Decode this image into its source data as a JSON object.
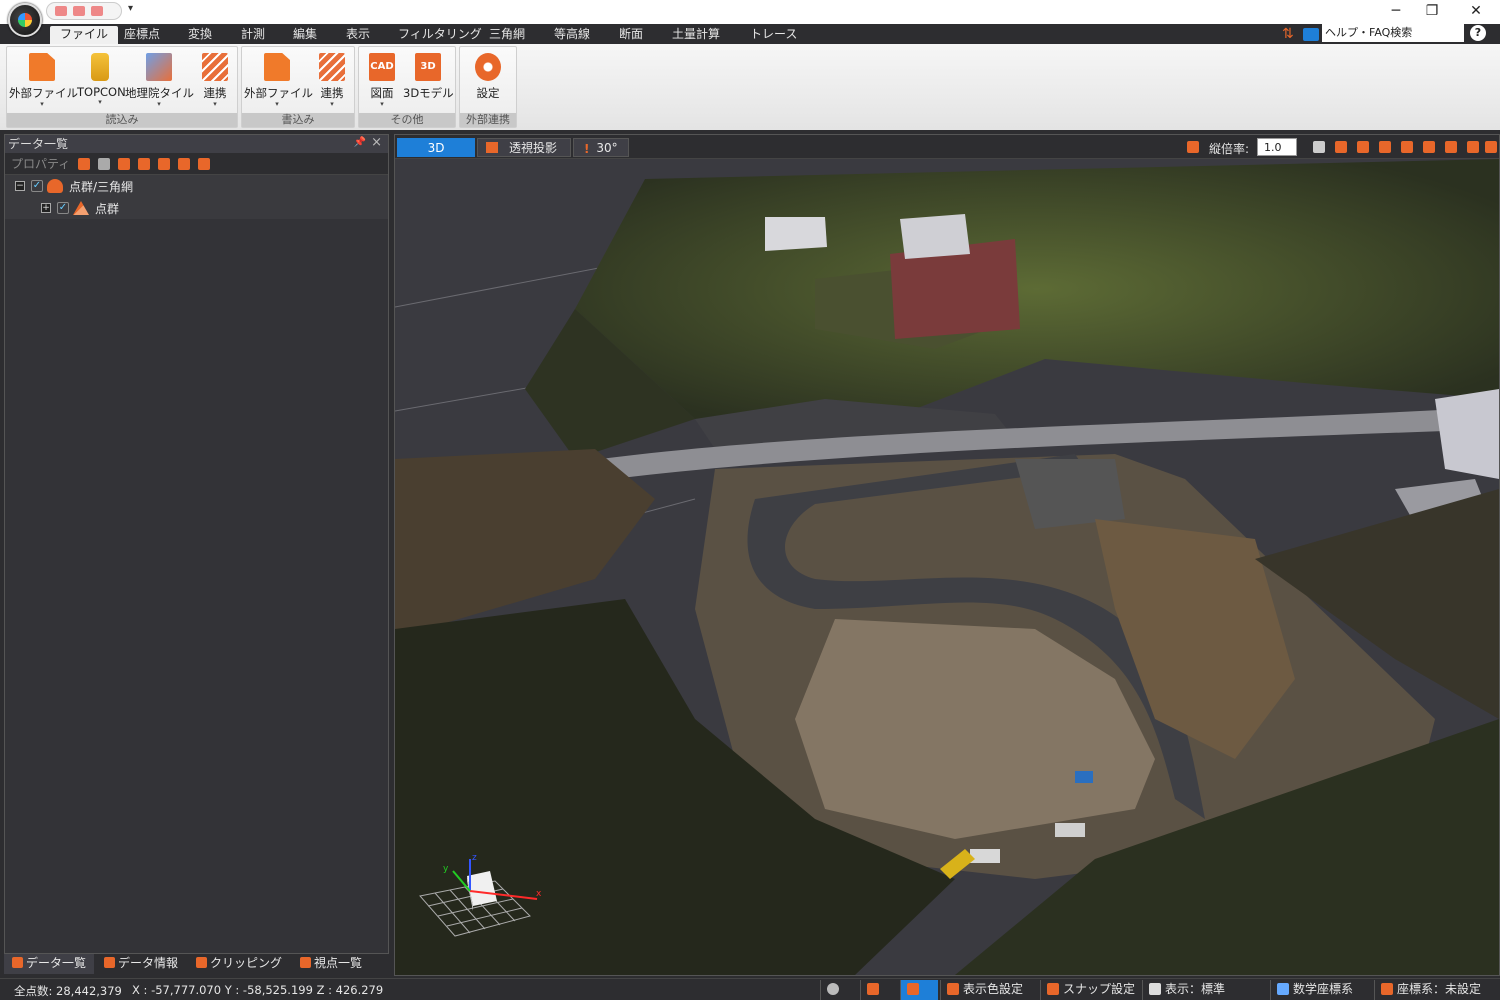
{
  "menu": {
    "tabs": [
      {
        "label": "ファイル"
      },
      {
        "label": "座標点"
      },
      {
        "label": "変換"
      },
      {
        "label": "計測"
      },
      {
        "label": "編集"
      },
      {
        "label": "表示"
      },
      {
        "label": "フィルタリング"
      },
      {
        "label": "三角網"
      },
      {
        "label": "等高線"
      },
      {
        "label": "断面"
      },
      {
        "label": "土量計算"
      },
      {
        "label": "トレース"
      }
    ],
    "help_search": "ヘルプ・FAQ検索"
  },
  "ribbon": {
    "groups": [
      {
        "label": "読込み",
        "buttons": [
          {
            "label": "外部ファイル"
          },
          {
            "label": "TOPCON"
          },
          {
            "label": "地理院タイル"
          },
          {
            "label": "連携"
          }
        ]
      },
      {
        "label": "書込み",
        "buttons": [
          {
            "label": "外部ファイル"
          },
          {
            "label": "連携"
          }
        ]
      },
      {
        "label": "その他",
        "buttons": [
          {
            "label": "図面",
            "icon_text": "CAD"
          },
          {
            "label": "3Dモデル",
            "icon_text": "3D"
          }
        ]
      },
      {
        "label": "外部連携",
        "buttons": [
          {
            "label": "設定"
          }
        ]
      }
    ]
  },
  "panel": {
    "title": "データ一覧",
    "toolbar_property": "プロパティ",
    "tree": [
      {
        "label": "点群/三角網",
        "expander": "−",
        "checked": "✓"
      },
      {
        "label": "点群",
        "expander": "+",
        "checked": "✓"
      }
    ],
    "tabs": [
      {
        "label": "データ一覧"
      },
      {
        "label": "データ情報"
      },
      {
        "label": "クリッピング"
      },
      {
        "label": "視点一覧"
      }
    ]
  },
  "view": {
    "tabs": [
      {
        "label": "3D"
      },
      {
        "label": "透視投影"
      },
      {
        "label": "30°"
      }
    ],
    "ratio_label": "縦倍率:",
    "ratio_value": "1.0"
  },
  "status": {
    "total_points": "全点数: 28,442,379",
    "coords": "X : -57,777.070  Y : -58,525.199  Z : 426.279",
    "buttons": [
      {
        "label": "表示色設定"
      },
      {
        "label": "スナップ設定"
      },
      {
        "label": "表示：標準"
      },
      {
        "label": "数学座標系"
      },
      {
        "label": "座標系：未設定"
      }
    ]
  },
  "colors": {
    "accent": "#e8672a",
    "selection": "#1e7fd8",
    "background": "#2d2d30"
  }
}
